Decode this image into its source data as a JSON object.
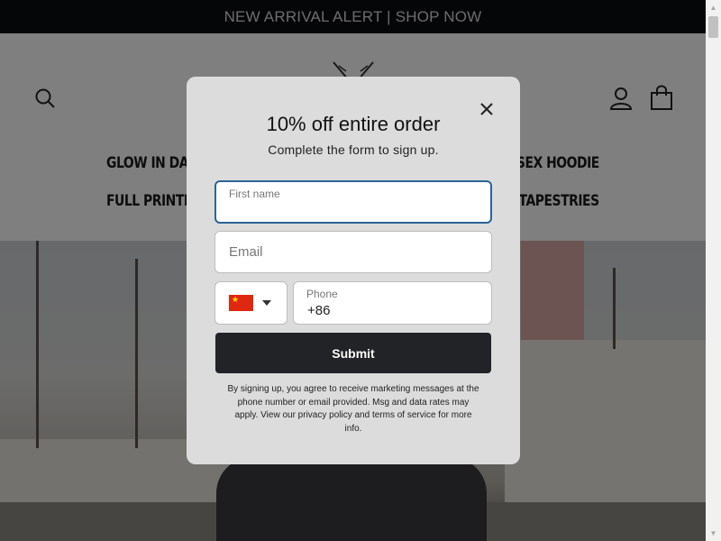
{
  "announcement": {
    "text": "NEW ARRIVAL ALERT | SHOP NOW"
  },
  "header": {
    "nav_row1": {
      "left": "GLOW IN DAR",
      "right": "ISEX HOODIE"
    },
    "nav_row2": {
      "left": "FULL PRINTED",
      "right": "TAPESTRIES"
    }
  },
  "modal": {
    "title": "10% off entire order",
    "subtitle": "Complete the form to sign up.",
    "first_name_label": "First name",
    "email_placeholder": "Email",
    "country_flag": "china-flag",
    "phone_label": "Phone",
    "phone_value": "+86",
    "submit_label": "Submit",
    "disclaimer": "By signing up, you agree to receive marketing messages at the phone number or email provided. Msg and data rates may apply. View our privacy policy and terms of service for more info."
  },
  "icons": {
    "search": "search-icon",
    "account": "account-icon",
    "cart": "cart-icon",
    "close": "close-icon",
    "caret": "caret-down-icon"
  },
  "colors": {
    "announcement_bg": "#0b0c0f",
    "modal_bg": "#dcdcdc",
    "submit_bg": "#222326",
    "input_focus": "#2a6496",
    "flag_red": "#de2910"
  }
}
